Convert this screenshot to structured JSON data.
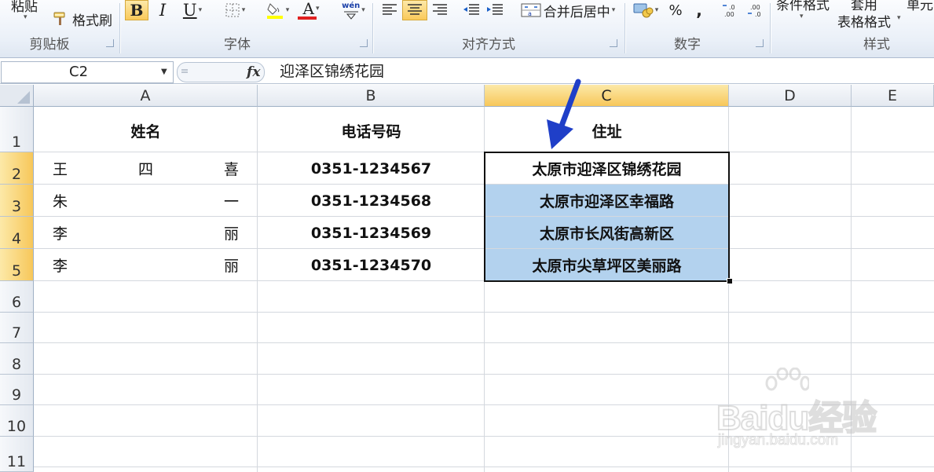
{
  "ribbon": {
    "paste_label": "粘贴",
    "format_painter_label": "格式刷",
    "bold_label": "B",
    "italic_label": "I",
    "underline_label": "U",
    "font_color_label": "A",
    "phonetic_label": "wén",
    "merge_center_label": "合并后居中",
    "percent_label": "%",
    "comma_label": ",",
    "conditional_format_label": "条件格式",
    "apply_label": "套用",
    "table_format_label": "表格格式",
    "cell_label": "单元",
    "groups": {
      "clipboard": "剪贴板",
      "font": "字体",
      "alignment": "对齐方式",
      "number": "数字",
      "styles": "样式"
    }
  },
  "formula_bar": {
    "name_box": "C2",
    "fx_label": "fx",
    "content": "迎泽区锦绣花园"
  },
  "columns": [
    "A",
    "B",
    "C",
    "D",
    "E"
  ],
  "selected_column": "C",
  "rows": [
    "1",
    "2",
    "3",
    "4",
    "5",
    "6",
    "7",
    "8",
    "9",
    "10",
    "11"
  ],
  "selected_rows": [
    "2",
    "3",
    "4",
    "5"
  ],
  "sheet": {
    "header": {
      "name": "姓名",
      "phone": "电话号码",
      "address": "住址"
    },
    "data": [
      {
        "name_parts": [
          "王",
          "四",
          "喜"
        ],
        "phone": "0351-1234567",
        "address": "太原市迎泽区锦绣花园"
      },
      {
        "name_parts": [
          "朱",
          "",
          "一"
        ],
        "phone": "0351-1234568",
        "address": "太原市迎泽区幸福路"
      },
      {
        "name_parts": [
          "李",
          "",
          "丽"
        ],
        "phone": "0351-1234569",
        "address": "太原市长风街高新区"
      },
      {
        "name_parts": [
          "李",
          "",
          "丽"
        ],
        "phone": "0351-1234570",
        "address": "太原市尖草坪区美丽路"
      }
    ]
  },
  "watermark": {
    "brand": "Baidu经验",
    "url": "jingyan.baidu.com"
  },
  "colors": {
    "selection_fill": "#b3d2ee",
    "header_highlight": "#f7c75a",
    "arrow": "#1f3fc8"
  },
  "icons": [
    "format-painter-icon",
    "border-icon",
    "fill-color-icon",
    "align-icons",
    "indent-icons",
    "merge-icon",
    "currency-icon",
    "decimal-icons",
    "fx-icon",
    "annotation-arrow-icon"
  ]
}
